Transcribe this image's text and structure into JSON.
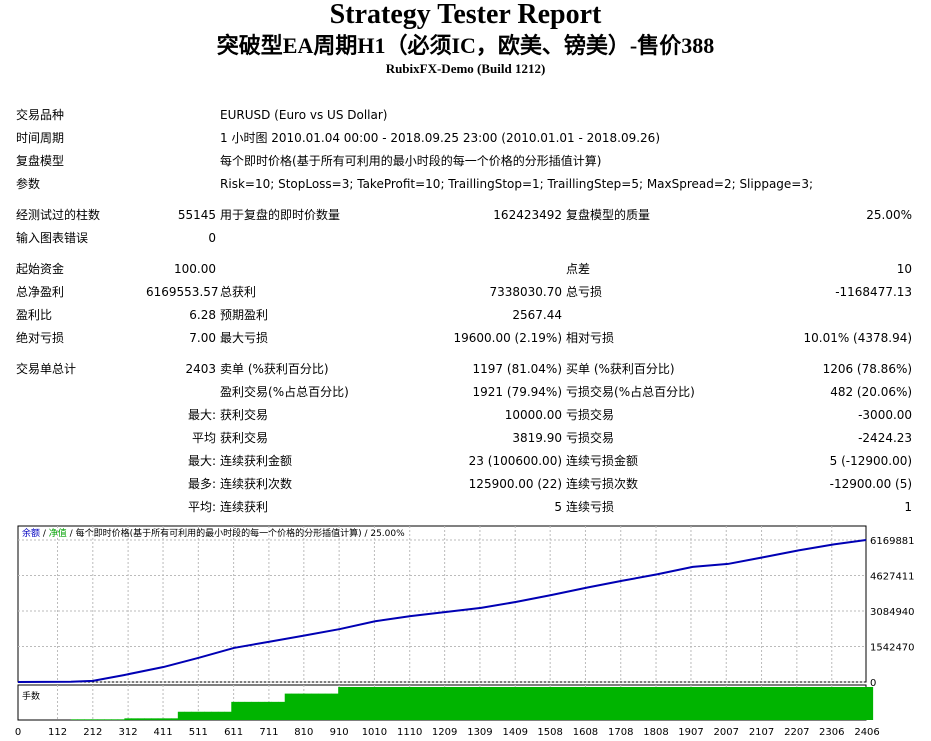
{
  "header": {
    "title": "Strategy Tester Report",
    "subtitle": "突破型EA周期H1（必须IC，欧美、镑美）-售价388",
    "build": "RubixFX-Demo (Build 1212)"
  },
  "info": {
    "symbol_label": "交易品种",
    "symbol_value": "EURUSD (Euro vs US Dollar)",
    "period_label": "时间周期",
    "period_value": "1 小时图 2010.01.04 00:00 - 2018.09.25 23:00 (2010.01.01 - 2018.09.26)",
    "model_label": "复盘模型",
    "model_value": "每个即时价格(基于所有可利用的最小时段的每一个价格的分形插值计算)",
    "params_label": "参数",
    "params_value": "Risk=10; StopLoss=3; TakeProfit=10; TraillingStop=1; TraillingStep=5; MaxSpread=2; Slippage=3;"
  },
  "stats": {
    "bars_label": "经测试过的柱数",
    "bars_value": "55145",
    "ticks_label": "用于复盘的即时价数量",
    "ticks_value": "162423492",
    "quality_label": "复盘模型的质量",
    "quality_value": "25.00%",
    "errors_label": "输入图表错误",
    "errors_value": "0",
    "deposit_label": "起始资金",
    "deposit_value": "100.00",
    "spread_label": "点差",
    "spread_value": "10",
    "net_label": "总净盈利",
    "net_value": "6169553.57",
    "gross_profit_label": "总获利",
    "gross_profit_value": "7338030.70",
    "gross_loss_label": "总亏损",
    "gross_loss_value": "-1168477.13",
    "pf_label": "盈利比",
    "pf_value": "6.28",
    "expected_label": "预期盈利",
    "expected_value": "2567.44",
    "abs_dd_label": "绝对亏损",
    "abs_dd_value": "7.00",
    "max_dd_label": "最大亏损",
    "max_dd_value": "19600.00 (2.19%)",
    "rel_dd_label": "相对亏损",
    "rel_dd_value": "10.01% (4378.94)",
    "trades_label": "交易单总计",
    "trades_value": "2403",
    "short_label": "卖单 (%获利百分比)",
    "short_value": "1197 (81.04%)",
    "long_label": "买单 (%获利百分比)",
    "long_value": "1206 (78.86%)",
    "profit_trades_label": "盈利交易(%占总百分比)",
    "profit_trades_value": "1921 (79.94%)",
    "loss_trades_label": "亏损交易(%占总百分比)",
    "loss_trades_value": "482 (20.06%)",
    "largest_label": "最大:",
    "largest_profit_label": "获利交易",
    "largest_profit_value": "10000.00",
    "largest_loss_label": "亏损交易",
    "largest_loss_value": "-3000.00",
    "average_label": "平均",
    "average_profit_label": "获利交易",
    "average_profit_value": "3819.90",
    "average_loss_label": "亏损交易",
    "average_loss_value": "-2424.23",
    "max_label": "最大:",
    "max_cons_wins_label": "连续获利金额",
    "max_cons_wins_value": "23 (100600.00)",
    "max_cons_losses_label": "连续亏损金额",
    "max_cons_losses_value": "5 (-12900.00)",
    "maximal_label": "最多:",
    "maximal_cons_profit_label": "连续获利次数",
    "maximal_cons_profit_value": "125900.00 (22)",
    "maximal_cons_loss_label": "连续亏损次数",
    "maximal_cons_loss_value": "-12900.00 (5)",
    "avg_cons_label": "平均:",
    "avg_cons_wins_label": "连续获利",
    "avg_cons_wins_value": "5",
    "avg_cons_losses_label": "连续亏损",
    "avg_cons_losses_value": "1"
  },
  "chart_data": {
    "type": "line",
    "legend": {
      "balance": "余额",
      "sep1": " / ",
      "equity": "净值",
      "sep2": " / ",
      "model": "每个即时价格(基于所有可利用的最小时段的每一个价格的分形插值计算)",
      "sep3": " / ",
      "quality": "25.00%"
    },
    "volume_label": "手数",
    "colors": {
      "balance": "#0000b4",
      "volume": "#00b400",
      "grid": "#bbbbbb"
    },
    "ylim": [
      0,
      6169881
    ],
    "yticks": [
      0,
      1542470,
      3084940,
      4627411,
      6169881
    ],
    "ytick_labels": [
      "0",
      "1542470",
      "3084940",
      "4627411",
      "6169881"
    ],
    "xlim": [
      0,
      2403
    ],
    "xticks": [
      0,
      112,
      212,
      312,
      411,
      511,
      611,
      711,
      810,
      910,
      1010,
      1110,
      1209,
      1309,
      1409,
      1508,
      1608,
      1708,
      1808,
      1907,
      2007,
      2107,
      2207,
      2306,
      2406
    ],
    "x": [
      0,
      150,
      212,
      300,
      412,
      512,
      612,
      712,
      812,
      912,
      1012,
      1112,
      1212,
      1312,
      1412,
      1512,
      1612,
      1712,
      1812,
      1912,
      2012,
      2112,
      2212,
      2312,
      2403
    ],
    "balance": [
      100,
      10000,
      50000,
      300000,
      650000,
      1050000,
      1480000,
      1750000,
      2020000,
      2300000,
      2640000,
      2860000,
      3040000,
      3220000,
      3480000,
      3780000,
      4100000,
      4400000,
      4680000,
      5000000,
      5130000,
      5420000,
      5720000,
      5980000,
      6169553.57
    ],
    "volume_fill": [
      0.02,
      0.05,
      0.25,
      0.55,
      0.8,
      1.0
    ]
  }
}
